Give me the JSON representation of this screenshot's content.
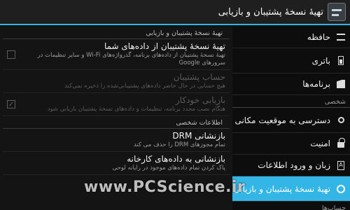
{
  "actionbar": {
    "title": "تهیهٔ نسخهٔ پشتیبان و بازیابی",
    "icon": "settings-app-icon"
  },
  "sidebar": {
    "items_top": [
      {
        "label": "حافظه",
        "icon": "storage-icon"
      },
      {
        "label": "باتری",
        "icon": "battery-icon"
      },
      {
        "label": "برنامه‌ها",
        "icon": "apps-icon"
      }
    ],
    "personal_header": "شخصی",
    "items_personal": [
      {
        "label": "دسترسی به موقعیت مکانی",
        "icon": "location-icon"
      },
      {
        "label": "امنیت",
        "icon": "lock-icon"
      },
      {
        "label": "زبان و ورود اطلاعات",
        "icon": "language-icon"
      },
      {
        "label": "تهیهٔ نسخهٔ پشتیبان و بازیابی",
        "icon": "backup-icon",
        "selected": true
      }
    ],
    "accounts_header": "حساب‌ها"
  },
  "main": {
    "backup_header": "تهیهٔ نسخهٔ پشتیبان و بازیابی",
    "backup_prefs": [
      {
        "title": "تهیهٔ نسخهٔ پشتیبان از داده‌های شما",
        "summary": "تهیهٔ نسخهٔ پشتیبان از داده‌های برنامه، گذرواژه‌های Wi-Fi و سایر تنظیمات در سرورهای Google",
        "checkbox": true,
        "checked": false,
        "enabled": true
      },
      {
        "title": "حساب پشتیبان",
        "summary": "هیچ حسابی در حال حاضر داده‌های پشتیبانی‌شده را ذخیره نمی‌کند",
        "checkbox": false,
        "enabled": false
      },
      {
        "title": "بازیابی خودکار",
        "summary": "هنگام نصب مجدد برنامه، تنظیمات و داده‌های نسخهٔ پشتیبان بازیابی شود",
        "checkbox": true,
        "checked": true,
        "enabled": false
      }
    ],
    "personal_header": "اطلاعات شخصی",
    "personal_prefs": [
      {
        "title": "بازنشانی DRM",
        "summary": "تمام مجوزهای DRM را حذف می کند"
      },
      {
        "title": "بازنشانی به داده‌های کارخانه",
        "summary": "پاک کردن تمام داده‌های موجود در رایانه لوحی"
      }
    ]
  },
  "watermark": "www.PCScience.ir"
}
